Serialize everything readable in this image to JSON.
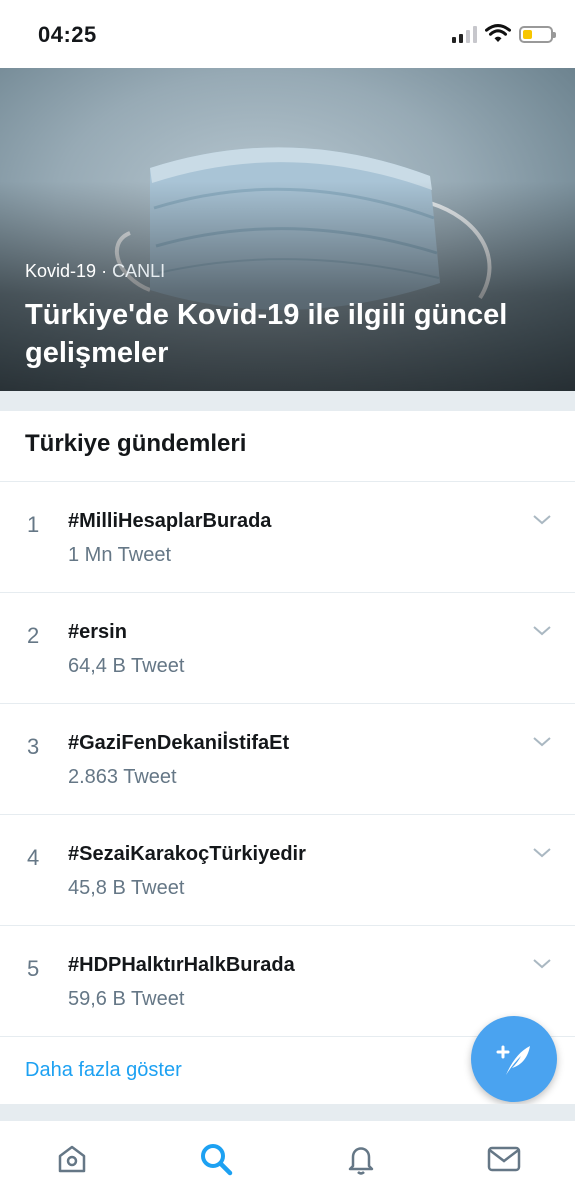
{
  "status_bar": {
    "time": "04:25"
  },
  "hero": {
    "category": "Kovid-19",
    "separator": "·",
    "live_label": "CANLI",
    "title": "Türkiye'de Kovid-19 ile ilgili güncel gelişmeler"
  },
  "trends": {
    "section_title": "Türkiye gündemleri",
    "items": [
      {
        "rank": "1",
        "tag": "#MilliHesaplarBurada",
        "count": "1 Mn Tweet"
      },
      {
        "rank": "2",
        "tag": "#ersin",
        "count": "64,4 B Tweet"
      },
      {
        "rank": "3",
        "tag": "#GaziFenDekaniİstifaEt",
        "count": "2.863 Tweet"
      },
      {
        "rank": "4",
        "tag": "#SezaiKarakoçTürkiyedir",
        "count": "45,8 B Tweet"
      },
      {
        "rank": "5",
        "tag": "#HDPHalktırHalkBurada",
        "count": "59,6 B Tweet"
      }
    ],
    "show_more": "Daha fazla göster"
  },
  "tab_bar": {
    "items": [
      {
        "icon": "home-icon",
        "active": false
      },
      {
        "icon": "search-icon",
        "active": true
      },
      {
        "icon": "bell-icon",
        "active": false
      },
      {
        "icon": "mail-icon",
        "active": false
      }
    ]
  },
  "colors": {
    "accent": "#1da1f2",
    "secondary_text": "#657786",
    "primary_text": "#14171a",
    "separator": "#e6ecf0"
  }
}
